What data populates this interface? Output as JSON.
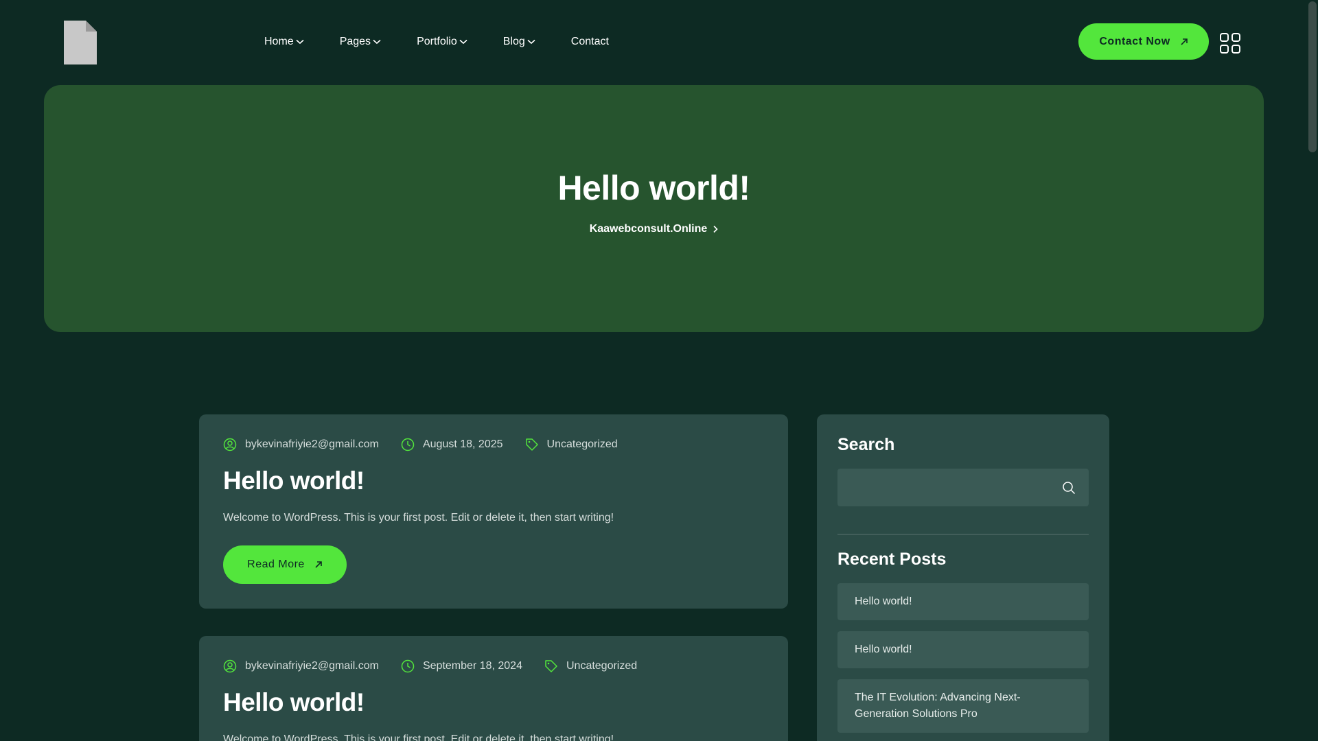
{
  "header": {
    "nav": [
      {
        "label": "Home",
        "has_dropdown": true
      },
      {
        "label": "Pages",
        "has_dropdown": true
      },
      {
        "label": "Portfolio",
        "has_dropdown": true
      },
      {
        "label": "Blog",
        "has_dropdown": true
      },
      {
        "label": "Contact",
        "has_dropdown": false
      }
    ],
    "contact_label": "Contact Now"
  },
  "hero": {
    "title": "Hello world!",
    "breadcrumb": "Kaawebconsult.Online"
  },
  "posts": [
    {
      "author": "bykevinafriyie2@gmail.com",
      "date": "August 18, 2025",
      "category": "Uncategorized",
      "title": "Hello world!",
      "excerpt": "Welcome to WordPress. This is your first post. Edit or delete it, then start writing!",
      "read_more": "Read More"
    },
    {
      "author": "bykevinafriyie2@gmail.com",
      "date": "September 18, 2024",
      "category": "Uncategorized",
      "title": "Hello world!",
      "excerpt": "Welcome to WordPress. This is your first post. Edit or delete it, then start writing!"
    }
  ],
  "sidebar": {
    "search_heading": "Search",
    "search_value": "",
    "recent_heading": "Recent Posts",
    "recent": [
      "Hello world!",
      "Hello world!",
      "The IT Evolution: Advancing Next-Generation Solutions Pro"
    ]
  },
  "colors": {
    "background": "#0d2a23",
    "hero": "#26542e",
    "card": "#2b4b46",
    "accent": "#53e63c"
  }
}
